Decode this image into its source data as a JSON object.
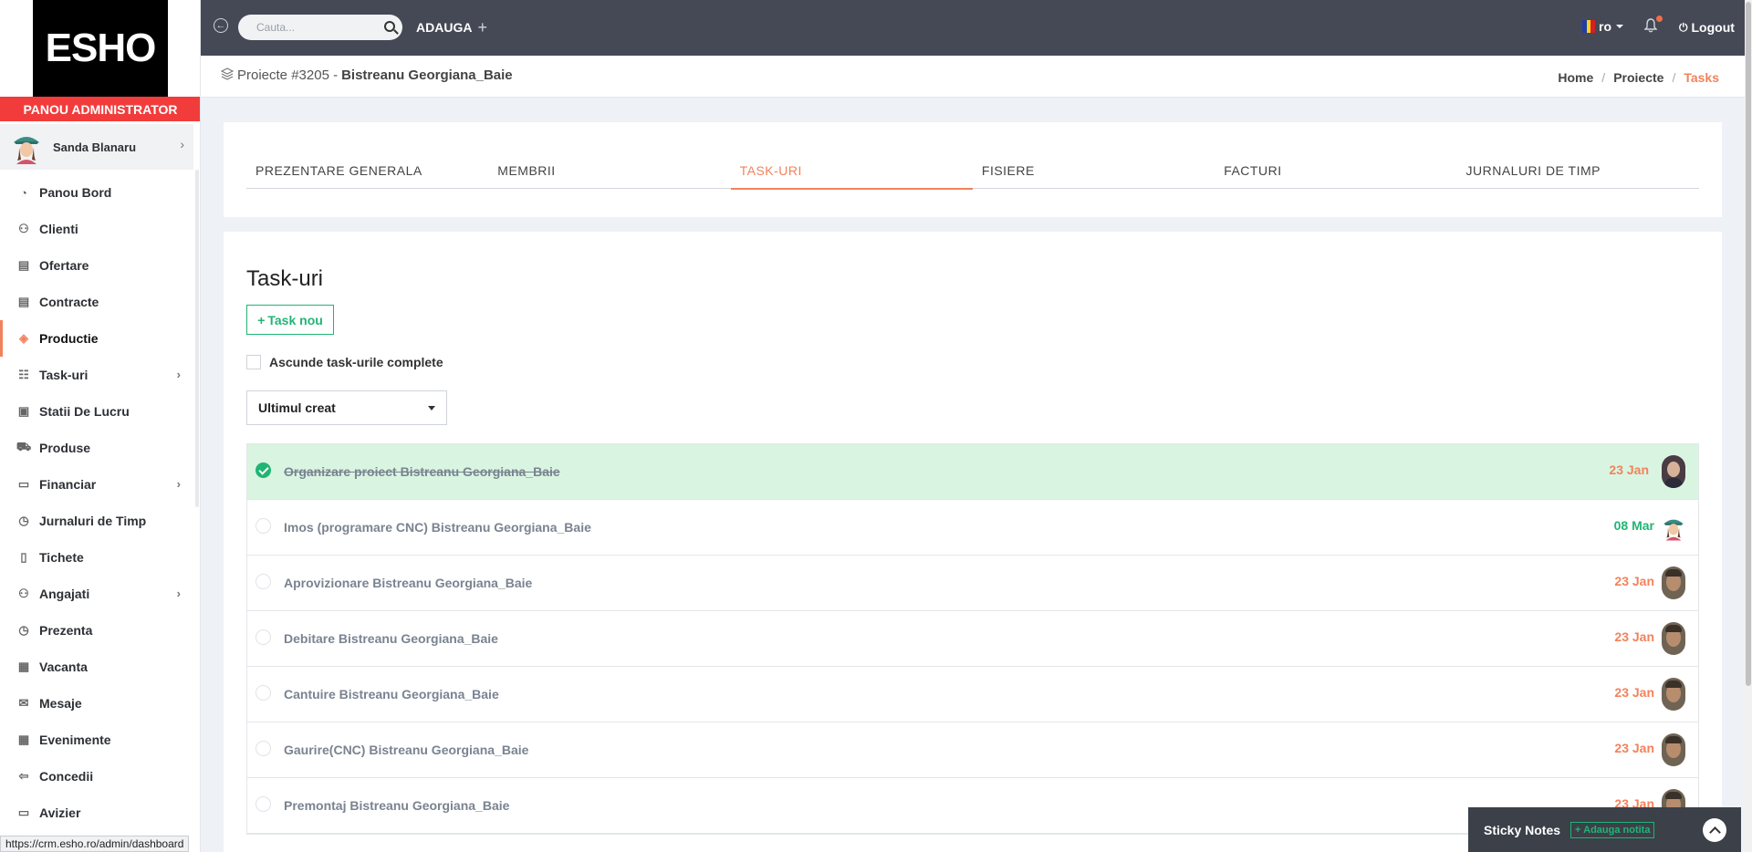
{
  "brand": {
    "logo_text": "ESHO",
    "admin_banner": "PANOU ADMINISTRATOR"
  },
  "user": {
    "name": "Sanda Blanaru"
  },
  "sidebar": {
    "items": [
      {
        "label": "Panou Bord",
        "icon": "dashboard-icon"
      },
      {
        "label": "Clienti",
        "icon": "user-icon"
      },
      {
        "label": "Ofertare",
        "icon": "document-icon"
      },
      {
        "label": "Contracte",
        "icon": "document-icon"
      },
      {
        "label": "Productie",
        "icon": "layers-icon",
        "active": true
      },
      {
        "label": "Task-uri",
        "icon": "tasks-icon",
        "has_submenu": true
      },
      {
        "label": "Statii De Lucru",
        "icon": "workstation-icon"
      },
      {
        "label": "Produse",
        "icon": "cart-icon"
      },
      {
        "label": "Financiar",
        "icon": "money-icon",
        "has_submenu": true
      },
      {
        "label": "Jurnaluri de Timp",
        "icon": "clock-icon"
      },
      {
        "label": "Tichete",
        "icon": "ticket-icon"
      },
      {
        "label": "Angajati",
        "icon": "user-icon",
        "has_submenu": true
      },
      {
        "label": "Prezenta",
        "icon": "clock-icon"
      },
      {
        "label": "Vacanta",
        "icon": "calendar-icon"
      },
      {
        "label": "Mesaje",
        "icon": "mail-icon"
      },
      {
        "label": "Evenimente",
        "icon": "calendar-grid-icon"
      },
      {
        "label": "Concedii",
        "icon": "exit-icon"
      },
      {
        "label": "Avizier",
        "icon": "monitor-icon"
      }
    ]
  },
  "topbar": {
    "search_placeholder": "Cauta...",
    "add_label": "ADAUGA",
    "language": "ro",
    "logout_label": "Logout"
  },
  "subheader": {
    "project_prefix": "Proiecte #3205 -",
    "project_name": "Bistreanu Georgiana_Baie",
    "breadcrumbs": [
      "Home",
      "Proiecte",
      "Tasks"
    ]
  },
  "tabs": [
    {
      "label": "PREZENTARE GENERALA"
    },
    {
      "label": "MEMBRII"
    },
    {
      "label": "TASK-URI",
      "active": true
    },
    {
      "label": "FISIERE"
    },
    {
      "label": "FACTURI"
    },
    {
      "label": "JURNALURI DE TIMP"
    }
  ],
  "tasks": {
    "title": "Task-uri",
    "new_task_label": "Task nou",
    "new_task_icon": "+",
    "hide_completed_label": "Ascunde task-urile complete",
    "sort_selected": "Ultimul creat",
    "items": [
      {
        "name": "Organizare proiect Bistreanu Georgiana_Baie",
        "date": "23 Jan",
        "done": true,
        "date_color": "#f2825c",
        "avatar": "man2"
      },
      {
        "name": "Imos (programare CNC) Bistreanu Georgiana_Baie",
        "date": "08 Mar",
        "done": false,
        "date_color": "#20b575",
        "avatar": "woman"
      },
      {
        "name": "Aprovizionare Bistreanu Georgiana_Baie",
        "date": "23 Jan",
        "done": false,
        "date_color": "#f2825c",
        "avatar": "man"
      },
      {
        "name": "Debitare Bistreanu Georgiana_Baie",
        "date": "23 Jan",
        "done": false,
        "date_color": "#f2825c",
        "avatar": "man"
      },
      {
        "name": "Cantuire Bistreanu Georgiana_Baie",
        "date": "23 Jan",
        "done": false,
        "date_color": "#f2825c",
        "avatar": "man"
      },
      {
        "name": "Gaurire(CNC) Bistreanu Georgiana_Baie",
        "date": "23 Jan",
        "done": false,
        "date_color": "#f2825c",
        "avatar": "man"
      },
      {
        "name": "Premontaj Bistreanu Georgiana_Baie",
        "date": "23 Jan",
        "done": false,
        "date_color": "#f2825c",
        "avatar": "man"
      }
    ]
  },
  "sticky_notes": {
    "title": "Sticky Notes",
    "add_label": "+ Adauga notita"
  },
  "status_url": "https://crm.esho.ro/admin/dashboard",
  "colors": {
    "accent": "#f2825c",
    "success": "#20b575",
    "topbar": "#444955",
    "banner": "#f23c3c"
  }
}
